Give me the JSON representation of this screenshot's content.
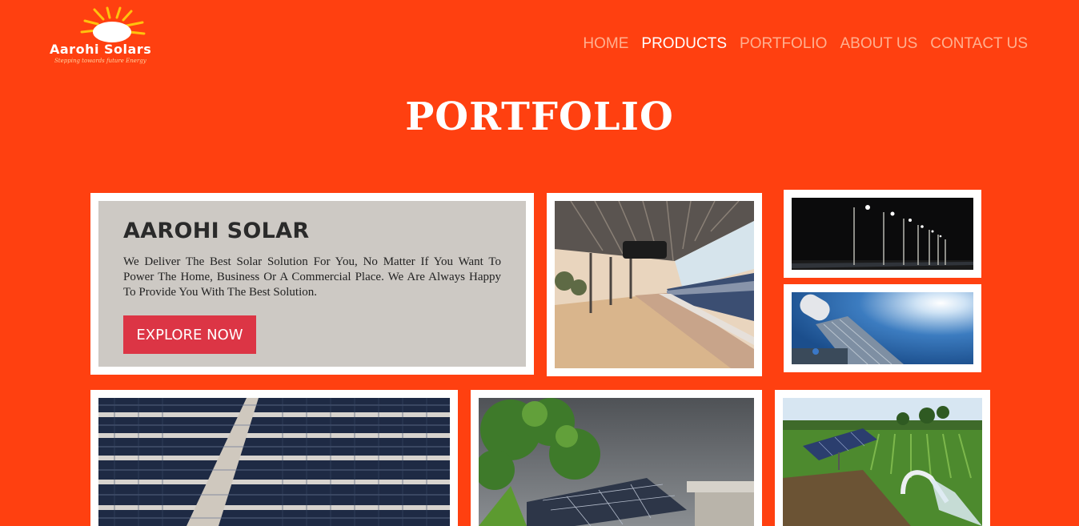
{
  "logo": {
    "name": "Aarohi Solars",
    "tagline": "Stepping towards future Energy"
  },
  "nav": [
    {
      "label": "HOME",
      "active": false
    },
    {
      "label": "PRODUCTS",
      "active": true
    },
    {
      "label": "PORTFOLIO",
      "active": false
    },
    {
      "label": "ABOUT US",
      "active": false
    },
    {
      "label": "CONTACT US",
      "active": false
    }
  ],
  "page": {
    "title": "PORTFOLIO"
  },
  "feature": {
    "title": "AAROHI SOLAR",
    "text": "We Deliver The Best Solar Solution For You, No Matter If You Want To Power The Home, Business Or A Commercial Place. We Are Always Happy To Provide You With The Best Solution.",
    "button": "EXPLORE NOW"
  },
  "colors": {
    "background": "#FF4010",
    "button": "#DC3545",
    "feature_panel": "#CDC9C4"
  }
}
